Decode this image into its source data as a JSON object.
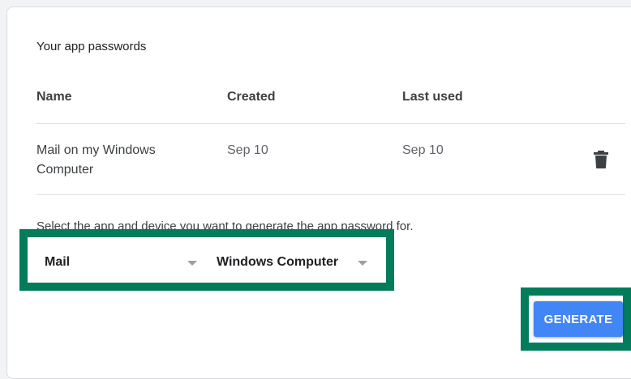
{
  "section_title": "Your app passwords",
  "table": {
    "columns": [
      "Name",
      "Created",
      "Last used"
    ],
    "rows": [
      {
        "name": "Mail on my Windows Computer",
        "created": "Sep 10",
        "last_used": "Sep 10",
        "action_icon": "trash-icon"
      }
    ]
  },
  "generator": {
    "instruction": "Select the app and device you want to generate the app password for.",
    "app_select": {
      "value": "Mail"
    },
    "device_select": {
      "value": "Windows Computer"
    },
    "generate_label": "GENERATE"
  },
  "colors": {
    "highlight": "#037c5c",
    "button": "#4285f4"
  }
}
